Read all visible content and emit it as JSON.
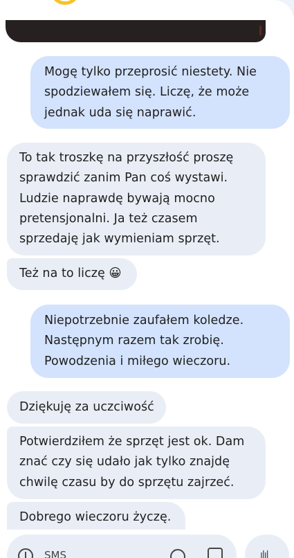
{
  "messages": [
    {
      "direction": "out",
      "text": "Mogę tylko przeprosić niestety. Nie spodziewałem się. Liczę, że może jednak uda się naprawić."
    },
    {
      "direction": "in",
      "text": "To tak troszkę na przyszłość proszę sprawdzić zanim Pan coś wystawi. Ludzie naprawdę bywają mocno pretensjonalni. Ja też czasem sprzedaję jak wymieniam sprzęt."
    },
    {
      "direction": "in",
      "text": "Też na to liczę 😀"
    },
    {
      "direction": "out",
      "text": "Niepotrzebnie zaufałem koledze. Następnym razem tak zrobię. Powodzenia i miłego wieczoru."
    },
    {
      "direction": "in",
      "text": "Dziękuję za uczciwość"
    },
    {
      "direction": "in",
      "text": "Potwierdziłem że sprzęt jest ok. Dam znać czy się udało jak tylko znajdę chwilę czasu by do sprzętu zajrzeć."
    },
    {
      "direction": "in",
      "text": "Dobrego wieczoru życzę."
    }
  ],
  "composer": {
    "placeholder": "SMS",
    "add_icon": "plus-circle-icon",
    "emoji_icon": "emoji-icon",
    "gallery_icon": "gallery-icon",
    "voice_icon": "voice-waveform-icon"
  },
  "colors": {
    "outgoing_bubble": "#d3e3fd",
    "incoming_bubble": "#e9eef6",
    "background": "#eef2f9",
    "avatar_accent": "#f7c325"
  }
}
